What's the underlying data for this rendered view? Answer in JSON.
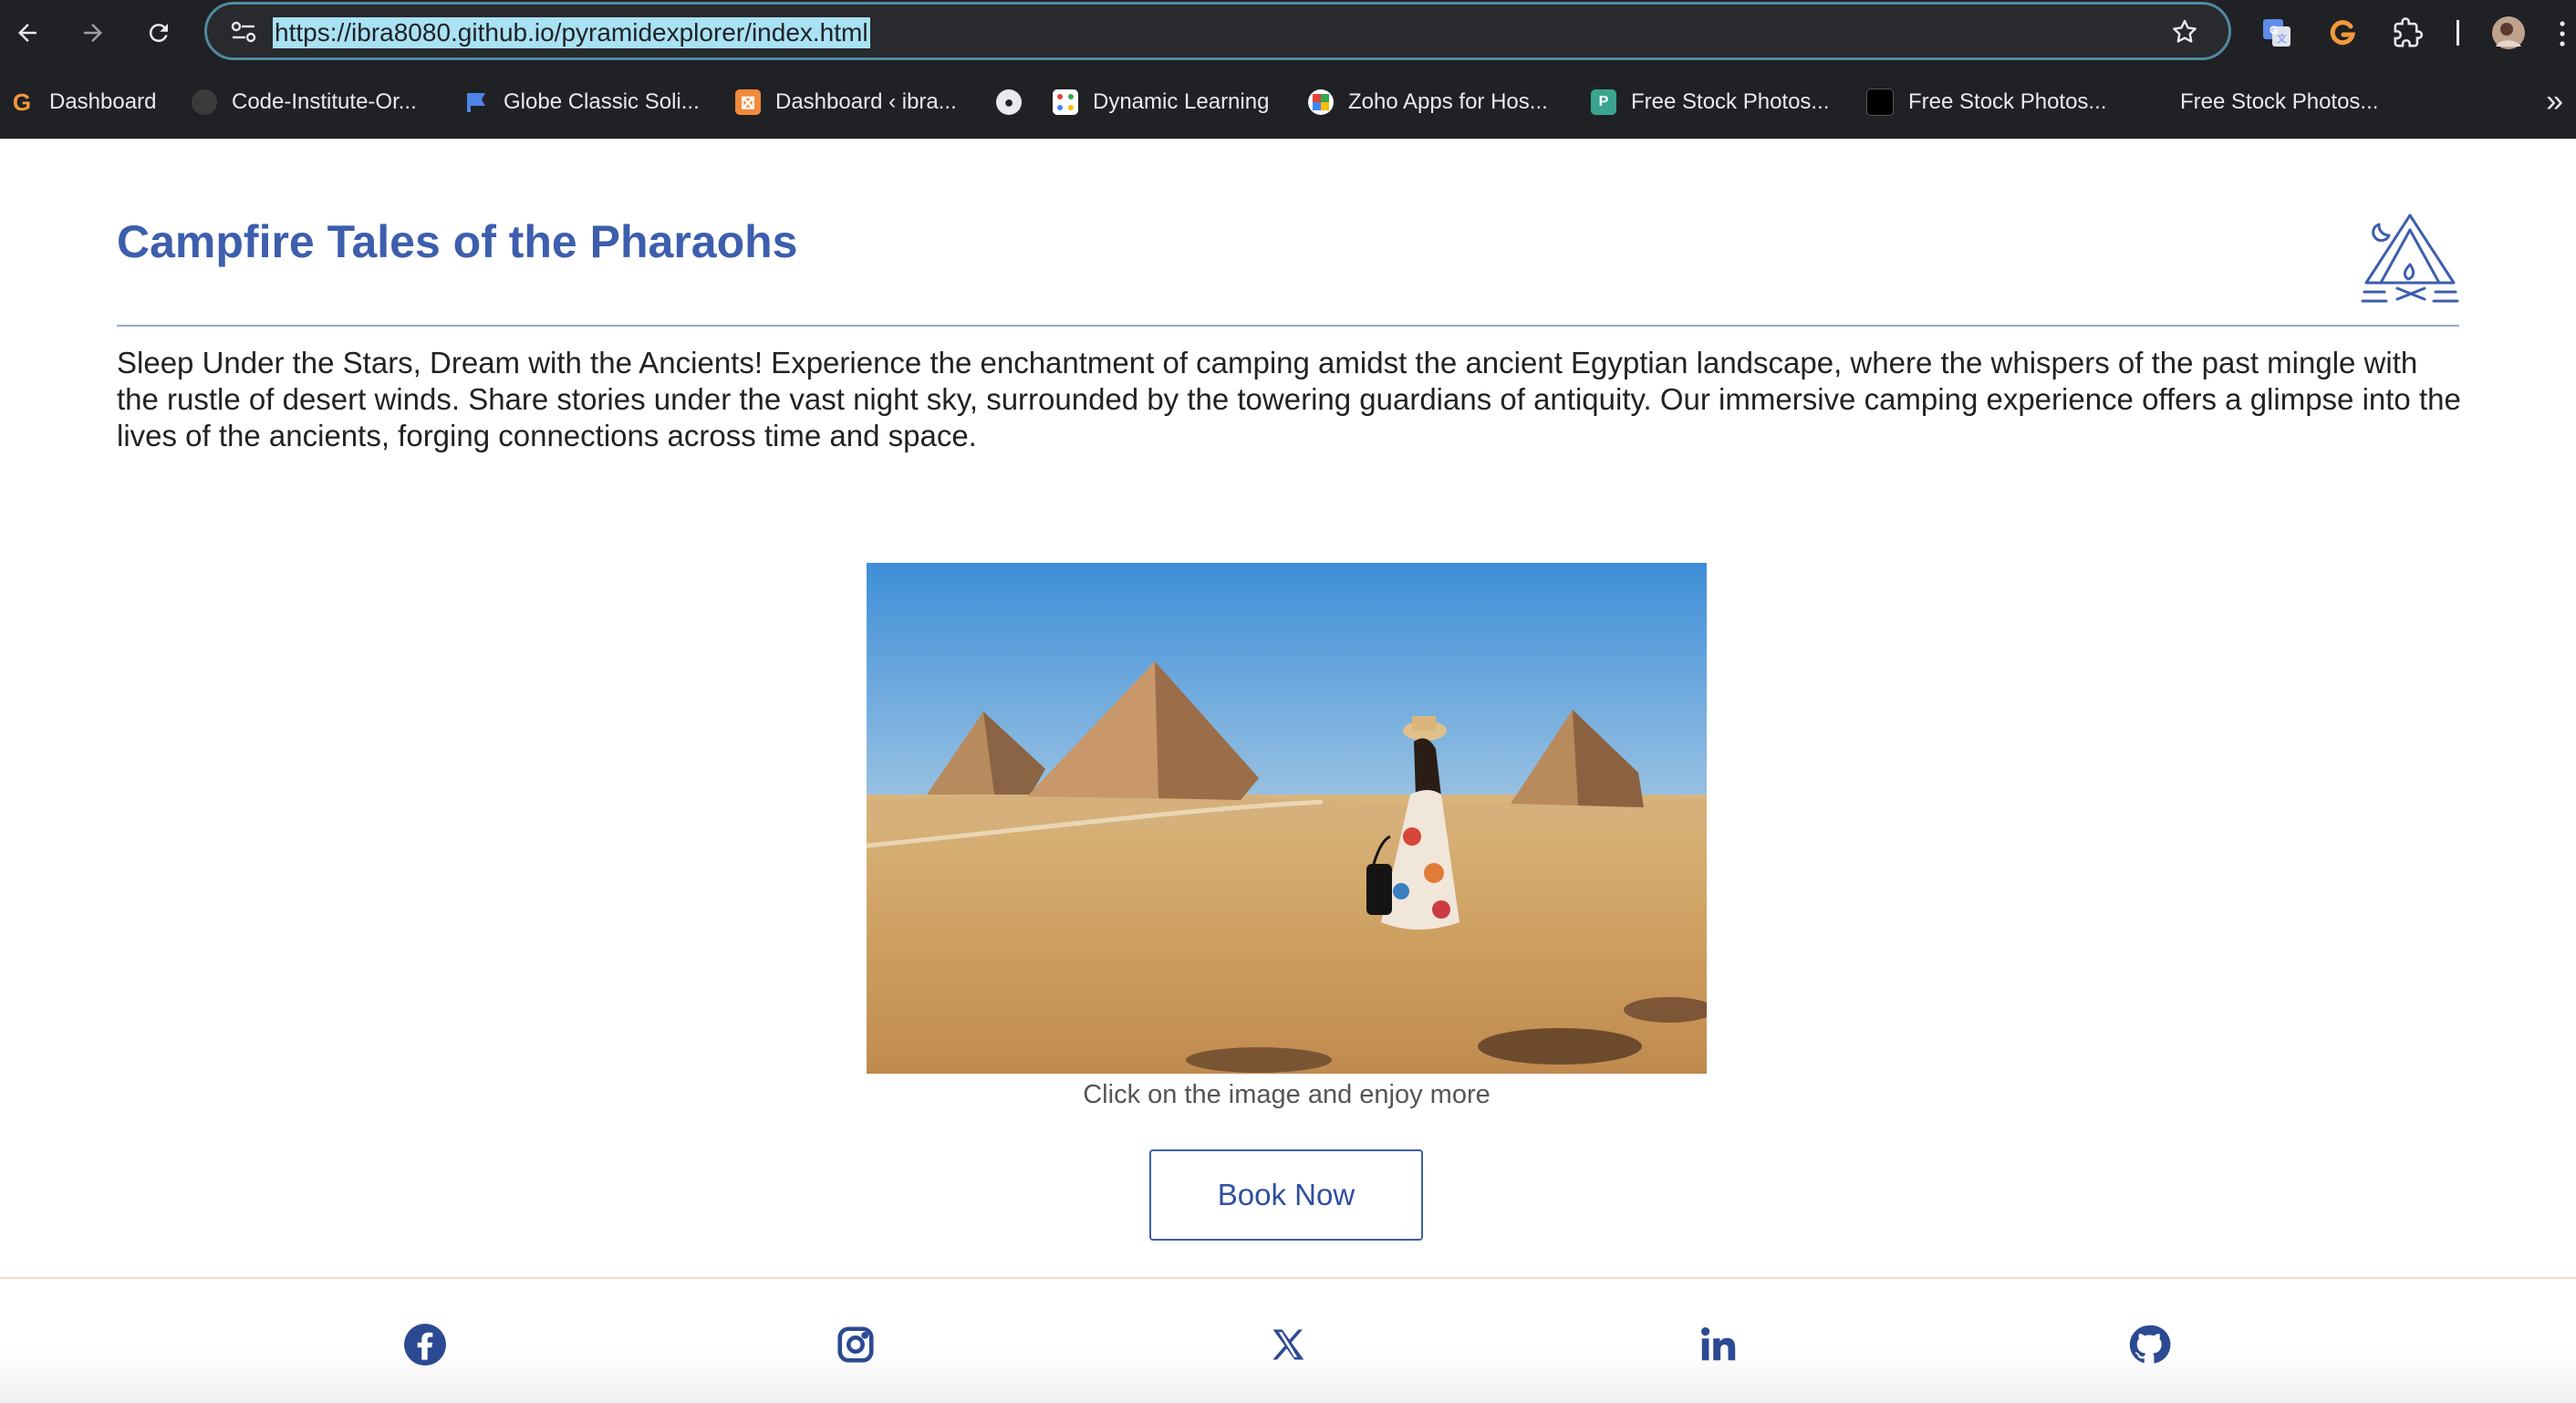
{
  "browser": {
    "url": "https://ibra8080.github.io/pyramidexplorer/index.html",
    "bookmarks": [
      {
        "label": "Dashboard",
        "icon": "grammarly-g-icon"
      },
      {
        "label": "Code-Institute-Or...",
        "icon": "github-icon"
      },
      {
        "label": "Globe Classic Soli...",
        "icon": "flag-icon"
      },
      {
        "label": "Dashboard ‹ ibra...",
        "icon": "xampp-icon"
      },
      {
        "label": "",
        "icon": "globe-icon"
      },
      {
        "label": "Dynamic Learning",
        "icon": "dots-grid-icon"
      },
      {
        "label": "Zoho Apps for Hos...",
        "icon": "zoho-icon"
      },
      {
        "label": "Free Stock Photos...",
        "icon": "photo-icon"
      },
      {
        "label": "Free Stock Photos...",
        "icon": "square-icon"
      },
      {
        "label": "Free Stock Photos...",
        "icon": "blank-icon"
      }
    ]
  },
  "section": {
    "title": "Campfire Tales of the Pharaohs",
    "icon": "campfire-tent-icon",
    "description": "Sleep Under the Stars, Dream with the Ancients! Experience the enchantment of camping amidst the ancient Egyptian landscape, where the whispers of the past mingle with the rustle of desert winds. Share stories under the vast night sky, surrounded by the towering guardians of antiquity. Our immersive camping experience offers a glimpse into the lives of the ancients, forging connections across time and space.",
    "image_icon": "pyramids-photo",
    "caption": "Click on the image and enjoy more",
    "button_label": "Book Now"
  },
  "footer": {
    "social": [
      "facebook-icon",
      "instagram-icon",
      "x-icon",
      "linkedin-icon",
      "github-icon"
    ]
  },
  "colors": {
    "title": "#3d5ead",
    "button_text": "#2f4fa0",
    "chrome_bg": "#202124",
    "url_highlight": "#a8e2f4",
    "footer_border": "#f3dcc2"
  }
}
